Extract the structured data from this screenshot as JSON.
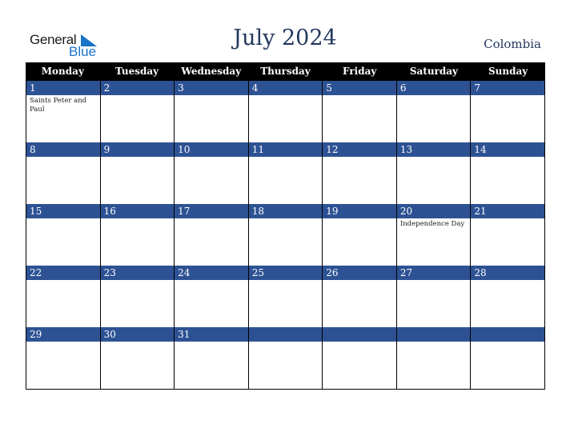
{
  "logo": {
    "text_top": "General",
    "text_bottom": "Blue"
  },
  "header": {
    "title": "July 2024",
    "country": "Colombia"
  },
  "weekdays": [
    "Monday",
    "Tuesday",
    "Wednesday",
    "Thursday",
    "Friday",
    "Saturday",
    "Sunday"
  ],
  "weeks": [
    [
      {
        "day": "1",
        "holiday": "Saints Peter and Paul"
      },
      {
        "day": "2",
        "holiday": ""
      },
      {
        "day": "3",
        "holiday": ""
      },
      {
        "day": "4",
        "holiday": ""
      },
      {
        "day": "5",
        "holiday": ""
      },
      {
        "day": "6",
        "holiday": ""
      },
      {
        "day": "7",
        "holiday": ""
      }
    ],
    [
      {
        "day": "8",
        "holiday": ""
      },
      {
        "day": "9",
        "holiday": ""
      },
      {
        "day": "10",
        "holiday": ""
      },
      {
        "day": "11",
        "holiday": ""
      },
      {
        "day": "12",
        "holiday": ""
      },
      {
        "day": "13",
        "holiday": ""
      },
      {
        "day": "14",
        "holiday": ""
      }
    ],
    [
      {
        "day": "15",
        "holiday": ""
      },
      {
        "day": "16",
        "holiday": ""
      },
      {
        "day": "17",
        "holiday": ""
      },
      {
        "day": "18",
        "holiday": ""
      },
      {
        "day": "19",
        "holiday": ""
      },
      {
        "day": "20",
        "holiday": "Independence Day"
      },
      {
        "day": "21",
        "holiday": ""
      }
    ],
    [
      {
        "day": "22",
        "holiday": ""
      },
      {
        "day": "23",
        "holiday": ""
      },
      {
        "day": "24",
        "holiday": ""
      },
      {
        "day": "25",
        "holiday": ""
      },
      {
        "day": "26",
        "holiday": ""
      },
      {
        "day": "27",
        "holiday": ""
      },
      {
        "day": "28",
        "holiday": ""
      }
    ],
    [
      {
        "day": "29",
        "holiday": ""
      },
      {
        "day": "30",
        "holiday": ""
      },
      {
        "day": "31",
        "holiday": ""
      },
      {
        "day": "",
        "holiday": ""
      },
      {
        "day": "",
        "holiday": ""
      },
      {
        "day": "",
        "holiday": ""
      },
      {
        "day": "",
        "holiday": ""
      }
    ]
  ],
  "colors": {
    "band": "#2d5294",
    "title": "#23375e",
    "logo_blue": "#1a73c9"
  }
}
